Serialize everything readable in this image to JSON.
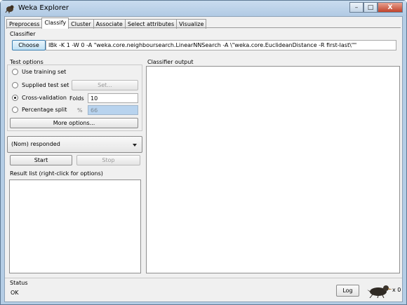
{
  "window": {
    "title": "Weka Explorer",
    "controls": [
      "–",
      "□",
      "X"
    ]
  },
  "tabs": [
    {
      "label": "Preprocess",
      "active": false
    },
    {
      "label": "Classify",
      "active": true
    },
    {
      "label": "Cluster",
      "active": false
    },
    {
      "label": "Associate",
      "active": false
    },
    {
      "label": "Select attributes",
      "active": false
    },
    {
      "label": "Visualize",
      "active": false
    }
  ],
  "classifier": {
    "section_label": "Classifier",
    "choose_label": "Choose",
    "config_text": "IBk -K 1 -W 0 -A \"weka.core.neighboursearch.LinearNNSearch -A \\\"weka.core.EuclideanDistance -R first-last\\\"\""
  },
  "test_options": {
    "section_label": "Test options",
    "options": [
      {
        "label": "Use training set",
        "checked": false
      },
      {
        "label": "Supplied test set",
        "checked": false
      },
      {
        "label": "Cross-validation",
        "checked": true
      },
      {
        "label": "Percentage split",
        "checked": false
      }
    ],
    "set_button": "Set...",
    "folds_label": "Folds",
    "folds_value": "10",
    "percent_label": "%",
    "percent_value": "66",
    "more_options_button": "More options..."
  },
  "class_attribute": {
    "selected": "(Nom) responded"
  },
  "actions": {
    "start": "Start",
    "stop": "Stop"
  },
  "result_list": {
    "label": "Result list (right-click for options)"
  },
  "classifier_output": {
    "label": "Classifier output"
  },
  "status": {
    "section_label": "Status",
    "text": "OK",
    "log_button": "Log",
    "task_count": "x 0"
  },
  "colors": {
    "window_frame": "#b4cde5",
    "panel_bg": "#f0f0f0",
    "disabled_field": "#b8d3ee",
    "primary_button": "#bfe0f4"
  }
}
